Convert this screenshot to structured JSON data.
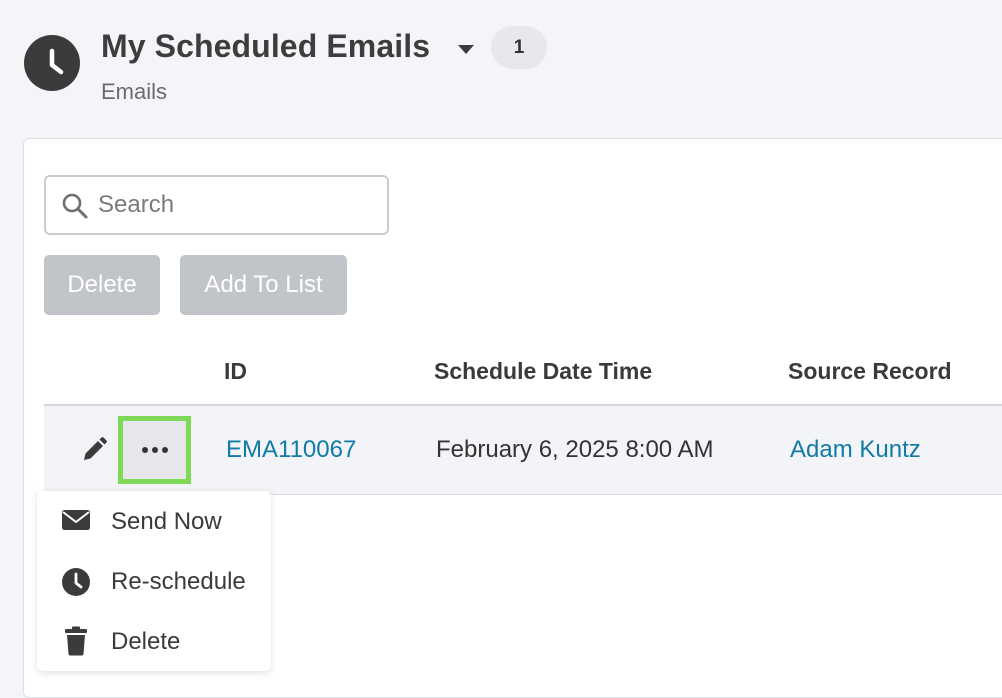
{
  "header": {
    "title": "My Scheduled Emails",
    "count": "1",
    "subtitle": "Emails",
    "icon": "clock-icon"
  },
  "toolbar": {
    "search_placeholder": "Search",
    "delete_label": "Delete",
    "add_to_list_label": "Add To List"
  },
  "table": {
    "columns": [
      "ID",
      "Schedule Date Time",
      "Source Record"
    ],
    "rows": [
      {
        "id": "EMA110067",
        "schedule_date_time": "February 6, 2025 8:00 AM",
        "source_record": "Adam Kuntz"
      }
    ]
  },
  "row_menu": {
    "items": [
      {
        "label": "Send Now",
        "icon": "envelope-icon"
      },
      {
        "label": "Re-schedule",
        "icon": "clock-icon"
      },
      {
        "label": "Delete",
        "icon": "trash-icon"
      }
    ]
  },
  "colors": {
    "accent_link": "#0f7ba6",
    "highlight": "#7ed957",
    "disabled_button": "#c1c4c8",
    "icon_dark": "#3b3b3b"
  }
}
